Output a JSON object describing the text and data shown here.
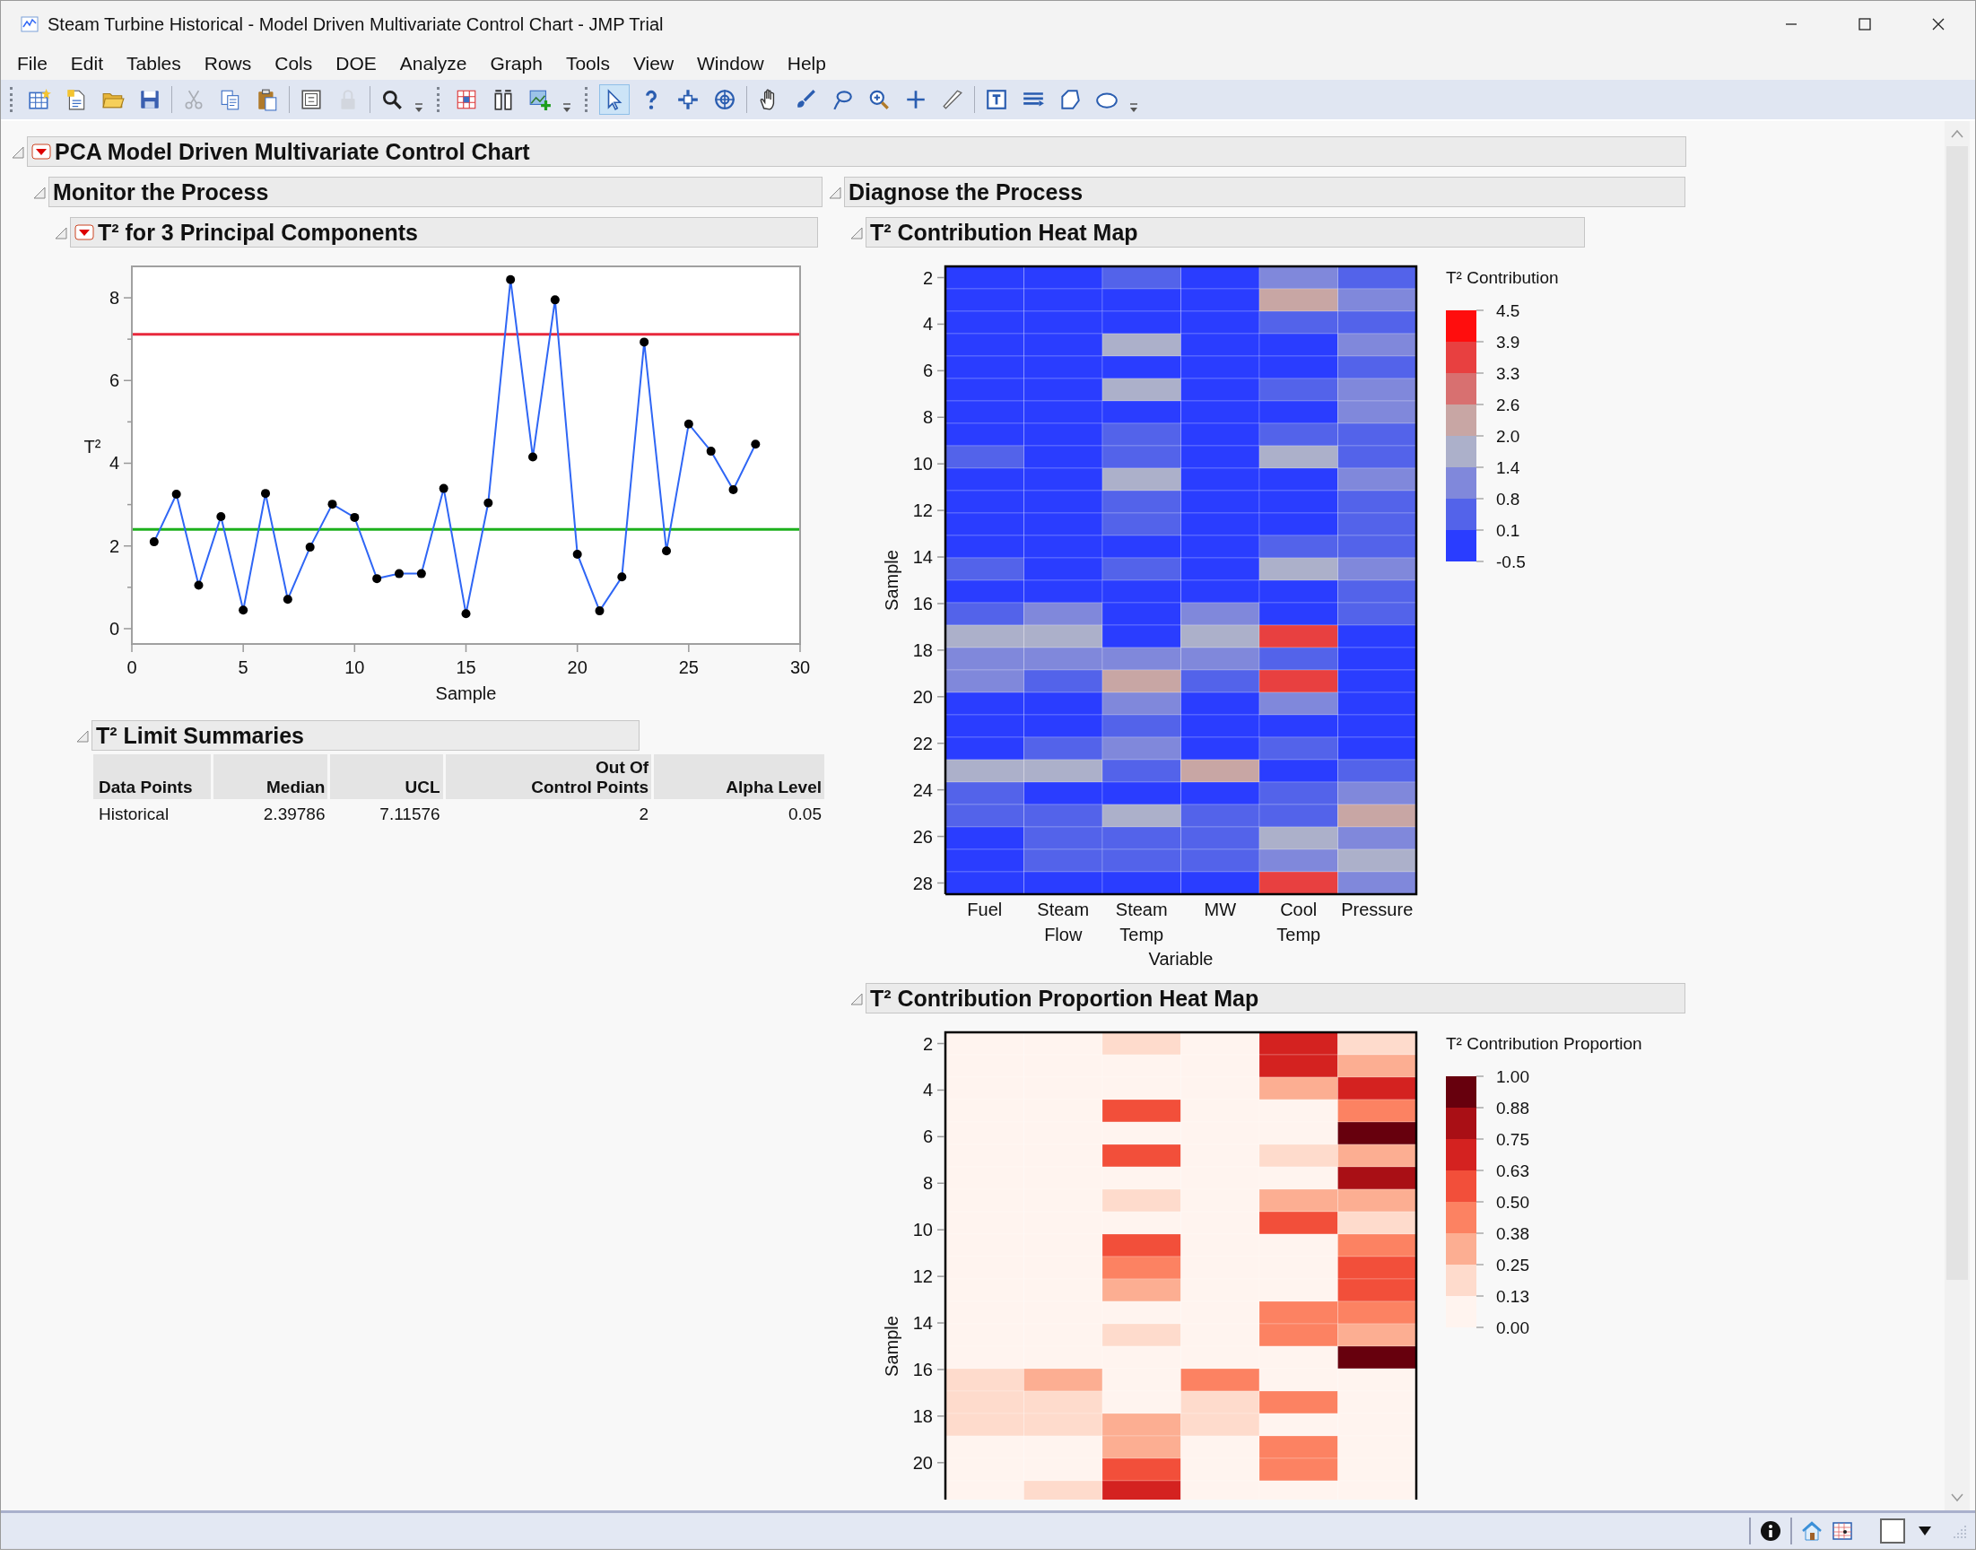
{
  "window": {
    "title": "Steam Turbine Historical - Model Driven Multivariate Control Chart - JMP Trial"
  },
  "menu": [
    "File",
    "Edit",
    "Tables",
    "Rows",
    "Cols",
    "DOE",
    "Analyze",
    "Graph",
    "Tools",
    "View",
    "Window",
    "Help"
  ],
  "toolbar": [
    {
      "items": [
        {
          "kind": "button",
          "selected": false,
          "disabled": false
        },
        {
          "kind": "button",
          "selected": false,
          "disabled": false
        },
        {
          "kind": "button",
          "selected": false,
          "disabled": false
        },
        {
          "kind": "button",
          "selected": false,
          "disabled": false
        },
        {
          "kind": "separator"
        },
        {
          "kind": "button",
          "selected": false,
          "disabled": true
        },
        {
          "kind": "button",
          "selected": false,
          "disabled": false
        },
        {
          "kind": "button",
          "selected": false,
          "disabled": false
        },
        {
          "kind": "separator"
        },
        {
          "kind": "button",
          "selected": false,
          "disabled": false
        },
        {
          "kind": "button",
          "selected": false,
          "disabled": true
        },
        {
          "kind": "separator"
        },
        {
          "kind": "button",
          "selected": false,
          "disabled": false
        },
        {
          "kind": "overflow"
        }
      ]
    },
    {
      "items": [
        {
          "kind": "button",
          "selected": false,
          "disabled": false
        },
        {
          "kind": "button",
          "selected": false,
          "disabled": false
        },
        {
          "kind": "button",
          "selected": false,
          "disabled": false
        },
        {
          "kind": "overflow"
        }
      ]
    },
    {
      "items": [
        {
          "kind": "button",
          "selected": true,
          "disabled": false
        },
        {
          "kind": "button",
          "selected": false,
          "disabled": false
        },
        {
          "kind": "button",
          "selected": false,
          "disabled": false
        },
        {
          "kind": "button",
          "selected": false,
          "disabled": false
        },
        {
          "kind": "separator"
        },
        {
          "kind": "button",
          "selected": false,
          "disabled": false
        },
        {
          "kind": "button",
          "selected": false,
          "disabled": false
        },
        {
          "kind": "button",
          "selected": false,
          "disabled": false
        },
        {
          "kind": "button",
          "selected": false,
          "disabled": false
        },
        {
          "kind": "button",
          "selected": false,
          "disabled": false
        },
        {
          "kind": "button",
          "selected": false,
          "disabled": false
        },
        {
          "kind": "separator"
        },
        {
          "kind": "button",
          "selected": false,
          "disabled": false
        },
        {
          "kind": "button",
          "selected": false,
          "disabled": false
        },
        {
          "kind": "button",
          "selected": false,
          "disabled": false
        },
        {
          "kind": "button",
          "selected": false,
          "disabled": false
        },
        {
          "kind": "overflow"
        }
      ]
    }
  ],
  "report": {
    "title": "PCA Model Driven Multivariate Control Chart",
    "menu_button": true,
    "expanded": true,
    "monitor": {
      "title": "Monitor the Process",
      "expanded": true,
      "t2_chart": {
        "title": "T² for 3 Principal Components",
        "menu_button": true,
        "expanded": true,
        "chart_data": {
          "type": "line",
          "xlabel": "Sample",
          "ylabel": "T²",
          "x": [
            1,
            2,
            3,
            4,
            5,
            6,
            7,
            8,
            9,
            10,
            11,
            12,
            13,
            14,
            15,
            16,
            17,
            18,
            19,
            20,
            21,
            22,
            23,
            24,
            25,
            26,
            27,
            28
          ],
          "xlim": [
            0,
            30
          ],
          "ylim": [
            -0.37,
            8.76
          ],
          "xticks": [
            0,
            5,
            10,
            15,
            20,
            25,
            30
          ],
          "yticks": [
            0,
            2,
            4,
            6,
            8
          ],
          "series": [
            {
              "color": "#2f66f5",
              "marker": "circle",
              "values": [
                2.1,
                3.25,
                1.05,
                2.71,
                0.45,
                3.27,
                0.71,
                1.97,
                3.01,
                2.69,
                1.21,
                1.33,
                1.33,
                3.39,
                0.36,
                3.04,
                8.44,
                4.15,
                7.95,
                1.8,
                0.43,
                1.25,
                6.93,
                1.88,
                4.95,
                4.29,
                3.36,
                4.46
              ]
            }
          ],
          "ref_lines": [
            {
              "axis": "y",
              "value": 7.11576,
              "color": "#e8283c"
            },
            {
              "axis": "y",
              "value": 2.39786,
              "color": "#1cb01c"
            }
          ]
        },
        "limit_summaries": {
          "title": "T² Limit Summaries",
          "expanded": true,
          "columns": [
            "Data Points",
            "Median",
            "UCL",
            "Out Of\nControl Points",
            "Alpha Level"
          ],
          "rows": [
            [
              "Historical",
              "2.39786",
              "7.11576",
              "2",
              "0.05"
            ]
          ]
        }
      }
    },
    "diagnose": {
      "title": "Diagnose the Process",
      "expanded": true,
      "contribution_map": {
        "title": "T² Contribution Heat Map",
        "expanded": true,
        "ylabel": "Sample",
        "xlabel": "Variable",
        "ytick_labels": [
          "2",
          "4",
          "6",
          "8",
          "10",
          "12",
          "14",
          "16",
          "18",
          "20",
          "22",
          "24",
          "26",
          "28"
        ],
        "column_labels": [
          "Fuel",
          "Steam\nFlow",
          "Steam\nTemp",
          "MW",
          "Cool\nTemp",
          "Pressure"
        ],
        "rows": [
          {
            "cells": [
              {
                "color": "#2a3dff"
              },
              {
                "color": "#2a3dff"
              },
              {
                "color": "#5363ea"
              },
              {
                "color": "#2a3dff"
              },
              {
                "color": "#8088db"
              },
              {
                "color": "#5363ea"
              }
            ]
          },
          {
            "cells": [
              {
                "color": "#2a3dff"
              },
              {
                "color": "#2a3dff"
              },
              {
                "color": "#2a3dff"
              },
              {
                "color": "#2a3dff"
              },
              {
                "color": "#c8a6a4"
              },
              {
                "color": "#8088db"
              }
            ]
          },
          {
            "cells": [
              {
                "color": "#2a3dff"
              },
              {
                "color": "#2a3dff"
              },
              {
                "color": "#2a3dff"
              },
              {
                "color": "#2a3dff"
              },
              {
                "color": "#5363ea"
              },
              {
                "color": "#5363ea"
              }
            ]
          },
          {
            "cells": [
              {
                "color": "#2a3dff"
              },
              {
                "color": "#2a3dff"
              },
              {
                "color": "#acb0ca"
              },
              {
                "color": "#2a3dff"
              },
              {
                "color": "#2a3dff"
              },
              {
                "color": "#8088db"
              }
            ]
          },
          {
            "cells": [
              {
                "color": "#2a3dff"
              },
              {
                "color": "#2a3dff"
              },
              {
                "color": "#2a3dff"
              },
              {
                "color": "#2a3dff"
              },
              {
                "color": "#2a3dff"
              },
              {
                "color": "#5363ea"
              }
            ]
          },
          {
            "cells": [
              {
                "color": "#2a3dff"
              },
              {
                "color": "#2a3dff"
              },
              {
                "color": "#acb0ca"
              },
              {
                "color": "#2a3dff"
              },
              {
                "color": "#5363ea"
              },
              {
                "color": "#8088db"
              }
            ]
          },
          {
            "cells": [
              {
                "color": "#2a3dff"
              },
              {
                "color": "#2a3dff"
              },
              {
                "color": "#2a3dff"
              },
              {
                "color": "#2a3dff"
              },
              {
                "color": "#2a3dff"
              },
              {
                "color": "#8088db"
              }
            ]
          },
          {
            "cells": [
              {
                "color": "#2a3dff"
              },
              {
                "color": "#2a3dff"
              },
              {
                "color": "#5363ea"
              },
              {
                "color": "#2a3dff"
              },
              {
                "color": "#5363ea"
              },
              {
                "color": "#5363ea"
              }
            ]
          },
          {
            "cells": [
              {
                "color": "#5363ea"
              },
              {
                "color": "#2a3dff"
              },
              {
                "color": "#5363ea"
              },
              {
                "color": "#2a3dff"
              },
              {
                "color": "#acb0ca"
              },
              {
                "color": "#5363ea"
              }
            ]
          },
          {
            "cells": [
              {
                "color": "#2a3dff"
              },
              {
                "color": "#2a3dff"
              },
              {
                "color": "#acb0ca"
              },
              {
                "color": "#2a3dff"
              },
              {
                "color": "#2a3dff"
              },
              {
                "color": "#8088db"
              }
            ]
          },
          {
            "cells": [
              {
                "color": "#2a3dff"
              },
              {
                "color": "#2a3dff"
              },
              {
                "color": "#5363ea"
              },
              {
                "color": "#2a3dff"
              },
              {
                "color": "#2a3dff"
              },
              {
                "color": "#5363ea"
              }
            ]
          },
          {
            "cells": [
              {
                "color": "#2a3dff"
              },
              {
                "color": "#2a3dff"
              },
              {
                "color": "#5363ea"
              },
              {
                "color": "#2a3dff"
              },
              {
                "color": "#2a3dff"
              },
              {
                "color": "#5363ea"
              }
            ]
          },
          {
            "cells": [
              {
                "color": "#2a3dff"
              },
              {
                "color": "#2a3dff"
              },
              {
                "color": "#2a3dff"
              },
              {
                "color": "#2a3dff"
              },
              {
                "color": "#5363ea"
              },
              {
                "color": "#5363ea"
              }
            ]
          },
          {
            "cells": [
              {
                "color": "#5363ea"
              },
              {
                "color": "#2a3dff"
              },
              {
                "color": "#5363ea"
              },
              {
                "color": "#2a3dff"
              },
              {
                "color": "#acb0ca"
              },
              {
                "color": "#8088db"
              }
            ]
          },
          {
            "cells": [
              {
                "color": "#2a3dff"
              },
              {
                "color": "#2a3dff"
              },
              {
                "color": "#2a3dff"
              },
              {
                "color": "#2a3dff"
              },
              {
                "color": "#2a3dff"
              },
              {
                "color": "#5363ea"
              }
            ]
          },
          {
            "cells": [
              {
                "color": "#5363ea"
              },
              {
                "color": "#8088db"
              },
              {
                "color": "#2a3dff"
              },
              {
                "color": "#8088db"
              },
              {
                "color": "#2a3dff"
              },
              {
                "color": "#5363ea"
              }
            ]
          },
          {
            "cells": [
              {
                "color": "#acb0ca"
              },
              {
                "color": "#acb0ca"
              },
              {
                "color": "#2a3dff"
              },
              {
                "color": "#acb0ca"
              },
              {
                "color": "#e84040"
              },
              {
                "color": "#2a3dff"
              }
            ]
          },
          {
            "cells": [
              {
                "color": "#8088db"
              },
              {
                "color": "#8088db"
              },
              {
                "color": "#8088db"
              },
              {
                "color": "#8088db"
              },
              {
                "color": "#5363ea"
              },
              {
                "color": "#2a3dff"
              }
            ]
          },
          {
            "cells": [
              {
                "color": "#8088db"
              },
              {
                "color": "#5363ea"
              },
              {
                "color": "#c8a6a4"
              },
              {
                "color": "#5363ea"
              },
              {
                "color": "#e84040"
              },
              {
                "color": "#2a3dff"
              }
            ]
          },
          {
            "cells": [
              {
                "color": "#2a3dff"
              },
              {
                "color": "#2a3dff"
              },
              {
                "color": "#8088db"
              },
              {
                "color": "#2a3dff"
              },
              {
                "color": "#8088db"
              },
              {
                "color": "#2a3dff"
              }
            ]
          },
          {
            "cells": [
              {
                "color": "#2a3dff"
              },
              {
                "color": "#2a3dff"
              },
              {
                "color": "#5363ea"
              },
              {
                "color": "#2a3dff"
              },
              {
                "color": "#2a3dff"
              },
              {
                "color": "#2a3dff"
              }
            ]
          },
          {
            "cells": [
              {
                "color": "#2a3dff"
              },
              {
                "color": "#5363ea"
              },
              {
                "color": "#8088db"
              },
              {
                "color": "#2a3dff"
              },
              {
                "color": "#5363ea"
              },
              {
                "color": "#2a3dff"
              }
            ]
          },
          {
            "cells": [
              {
                "color": "#acb0ca"
              },
              {
                "color": "#acb0ca"
              },
              {
                "color": "#5363ea"
              },
              {
                "color": "#c8a6a4"
              },
              {
                "color": "#2a3dff"
              },
              {
                "color": "#5363ea"
              }
            ]
          },
          {
            "cells": [
              {
                "color": "#5363ea"
              },
              {
                "color": "#2a3dff"
              },
              {
                "color": "#2a3dff"
              },
              {
                "color": "#2a3dff"
              },
              {
                "color": "#5363ea"
              },
              {
                "color": "#8088db"
              }
            ]
          },
          {
            "cells": [
              {
                "color": "#5363ea"
              },
              {
                "color": "#5363ea"
              },
              {
                "color": "#acb0ca"
              },
              {
                "color": "#5363ea"
              },
              {
                "color": "#5363ea"
              },
              {
                "color": "#c8a6a4"
              }
            ]
          },
          {
            "cells": [
              {
                "color": "#2a3dff"
              },
              {
                "color": "#5363ea"
              },
              {
                "color": "#5363ea"
              },
              {
                "color": "#5363ea"
              },
              {
                "color": "#acb0ca"
              },
              {
                "color": "#8088db"
              }
            ]
          },
          {
            "cells": [
              {
                "color": "#2a3dff"
              },
              {
                "color": "#5363ea"
              },
              {
                "color": "#5363ea"
              },
              {
                "color": "#5363ea"
              },
              {
                "color": "#8088db"
              },
              {
                "color": "#acb0ca"
              }
            ]
          },
          {
            "cells": [
              {
                "color": "#2a3dff"
              },
              {
                "color": "#2a3dff"
              },
              {
                "color": "#2a3dff"
              },
              {
                "color": "#2a3dff"
              },
              {
                "color": "#e84040"
              },
              {
                "color": "#8088db"
              }
            ]
          }
        ],
        "legend": {
          "title": "T² Contribution",
          "tick_labels": [
            "4.5",
            "3.9",
            "3.3",
            "2.6",
            "2.0",
            "1.4",
            "0.8",
            "0.1",
            "-0.5"
          ],
          "bands": [
            {
              "color": "#ff0d0d"
            },
            {
              "color": "#e84040"
            },
            {
              "color": "#d87070"
            },
            {
              "color": "#c8a6a4"
            },
            {
              "color": "#acb0ca"
            },
            {
              "color": "#8088db"
            },
            {
              "color": "#5363ea"
            },
            {
              "color": "#2a3dff"
            }
          ]
        }
      },
      "proportion_map": {
        "title": "T² Contribution Proportion Heat Map",
        "expanded": true,
        "ylabel": "Sample",
        "ytick_labels": [
          "2",
          "4",
          "6",
          "8",
          "10",
          "12",
          "14",
          "16",
          "18",
          "20"
        ],
        "rows": [
          {
            "cells": [
              {
                "color": "#fff4ef"
              },
              {
                "color": "#fff4ef"
              },
              {
                "color": "#fedbcc"
              },
              {
                "color": "#fff4ef"
              },
              {
                "color": "#d42220"
              },
              {
                "color": "#fedbcc"
              }
            ]
          },
          {
            "cells": [
              {
                "color": "#fff4ef"
              },
              {
                "color": "#fff4ef"
              },
              {
                "color": "#fff4ef"
              },
              {
                "color": "#fff4ef"
              },
              {
                "color": "#d42220"
              },
              {
                "color": "#fcae92"
              }
            ]
          },
          {
            "cells": [
              {
                "color": "#fff4ef"
              },
              {
                "color": "#fff4ef"
              },
              {
                "color": "#fff4ef"
              },
              {
                "color": "#fff4ef"
              },
              {
                "color": "#fcae92"
              },
              {
                "color": "#d42220"
              }
            ]
          },
          {
            "cells": [
              {
                "color": "#fff4ef"
              },
              {
                "color": "#fff4ef"
              },
              {
                "color": "#f24f3a"
              },
              {
                "color": "#fff4ef"
              },
              {
                "color": "#fff4ef"
              },
              {
                "color": "#fc8262"
              }
            ]
          },
          {
            "cells": [
              {
                "color": "#fff4ef"
              },
              {
                "color": "#fff4ef"
              },
              {
                "color": "#fff4ef"
              },
              {
                "color": "#fff4ef"
              },
              {
                "color": "#fff4ef"
              },
              {
                "color": "#67000d"
              }
            ]
          },
          {
            "cells": [
              {
                "color": "#fff4ef"
              },
              {
                "color": "#fff4ef"
              },
              {
                "color": "#f24f3a"
              },
              {
                "color": "#fff4ef"
              },
              {
                "color": "#fedbcc"
              },
              {
                "color": "#fcae92"
              }
            ]
          },
          {
            "cells": [
              {
                "color": "#fff4ef"
              },
              {
                "color": "#fff4ef"
              },
              {
                "color": "#fff4ef"
              },
              {
                "color": "#fff4ef"
              },
              {
                "color": "#fff4ef"
              },
              {
                "color": "#a90f15"
              }
            ]
          },
          {
            "cells": [
              {
                "color": "#fff4ef"
              },
              {
                "color": "#fff4ef"
              },
              {
                "color": "#fedbcc"
              },
              {
                "color": "#fff4ef"
              },
              {
                "color": "#fcae92"
              },
              {
                "color": "#fcae92"
              }
            ]
          },
          {
            "cells": [
              {
                "color": "#fff4ef"
              },
              {
                "color": "#fff4ef"
              },
              {
                "color": "#fff4ef"
              },
              {
                "color": "#fff4ef"
              },
              {
                "color": "#f24f3a"
              },
              {
                "color": "#fedbcc"
              }
            ]
          },
          {
            "cells": [
              {
                "color": "#fff4ef"
              },
              {
                "color": "#fff4ef"
              },
              {
                "color": "#f24f3a"
              },
              {
                "color": "#fff4ef"
              },
              {
                "color": "#fff4ef"
              },
              {
                "color": "#fc8262"
              }
            ]
          },
          {
            "cells": [
              {
                "color": "#fff4ef"
              },
              {
                "color": "#fff4ef"
              },
              {
                "color": "#fc8262"
              },
              {
                "color": "#fff4ef"
              },
              {
                "color": "#fff4ef"
              },
              {
                "color": "#f24f3a"
              }
            ]
          },
          {
            "cells": [
              {
                "color": "#fff4ef"
              },
              {
                "color": "#fff4ef"
              },
              {
                "color": "#fcae92"
              },
              {
                "color": "#fff4ef"
              },
              {
                "color": "#fff4ef"
              },
              {
                "color": "#f24f3a"
              }
            ]
          },
          {
            "cells": [
              {
                "color": "#fff4ef"
              },
              {
                "color": "#fff4ef"
              },
              {
                "color": "#fff4ef"
              },
              {
                "color": "#fff4ef"
              },
              {
                "color": "#fc8262"
              },
              {
                "color": "#fc8262"
              }
            ]
          },
          {
            "cells": [
              {
                "color": "#fff4ef"
              },
              {
                "color": "#fff4ef"
              },
              {
                "color": "#fedbcc"
              },
              {
                "color": "#fff4ef"
              },
              {
                "color": "#fc8262"
              },
              {
                "color": "#fcae92"
              }
            ]
          },
          {
            "cells": [
              {
                "color": "#fff4ef"
              },
              {
                "color": "#fff4ef"
              },
              {
                "color": "#fff4ef"
              },
              {
                "color": "#fff4ef"
              },
              {
                "color": "#fff4ef"
              },
              {
                "color": "#67000d"
              }
            ]
          },
          {
            "cells": [
              {
                "color": "#fedbcc"
              },
              {
                "color": "#fcae92"
              },
              {
                "color": "#fff4ef"
              },
              {
                "color": "#fc8262"
              },
              {
                "color": "#fff4ef"
              },
              {
                "color": "#fff4ef"
              }
            ]
          },
          {
            "cells": [
              {
                "color": "#fedbcc"
              },
              {
                "color": "#fedbcc"
              },
              {
                "color": "#fff4ef"
              },
              {
                "color": "#fedbcc"
              },
              {
                "color": "#fc8262"
              },
              {
                "color": "#fff4ef"
              }
            ]
          },
          {
            "cells": [
              {
                "color": "#fedbcc"
              },
              {
                "color": "#fedbcc"
              },
              {
                "color": "#fcae92"
              },
              {
                "color": "#fedbcc"
              },
              {
                "color": "#fff4ef"
              },
              {
                "color": "#fff4ef"
              }
            ]
          },
          {
            "cells": [
              {
                "color": "#fff4ef"
              },
              {
                "color": "#fff4ef"
              },
              {
                "color": "#fcae92"
              },
              {
                "color": "#fff4ef"
              },
              {
                "color": "#fc8262"
              },
              {
                "color": "#fff4ef"
              }
            ]
          },
          {
            "cells": [
              {
                "color": "#fff4ef"
              },
              {
                "color": "#fff4ef"
              },
              {
                "color": "#f24f3a"
              },
              {
                "color": "#fff4ef"
              },
              {
                "color": "#fc8262"
              },
              {
                "color": "#fff4ef"
              }
            ]
          },
          {
            "cells": [
              {
                "color": "#fff4ef"
              },
              {
                "color": "#fedbcc"
              },
              {
                "color": "#d42220"
              },
              {
                "color": "#fff4ef"
              },
              {
                "color": "#fff4ef"
              },
              {
                "color": "#fff4ef"
              }
            ]
          }
        ],
        "legend": {
          "title": "T² Contribution Proportion",
          "tick_labels": [
            "1.00",
            "0.88",
            "0.75",
            "0.63",
            "0.50",
            "0.38",
            "0.25",
            "0.13",
            "0.00"
          ],
          "bands": [
            {
              "color": "#67000d"
            },
            {
              "color": "#a90f15"
            },
            {
              "color": "#d42220"
            },
            {
              "color": "#f24f3a"
            },
            {
              "color": "#fc8262"
            },
            {
              "color": "#fcae92"
            },
            {
              "color": "#fedbcc"
            },
            {
              "color": "#fff4ef"
            }
          ]
        }
      }
    }
  }
}
